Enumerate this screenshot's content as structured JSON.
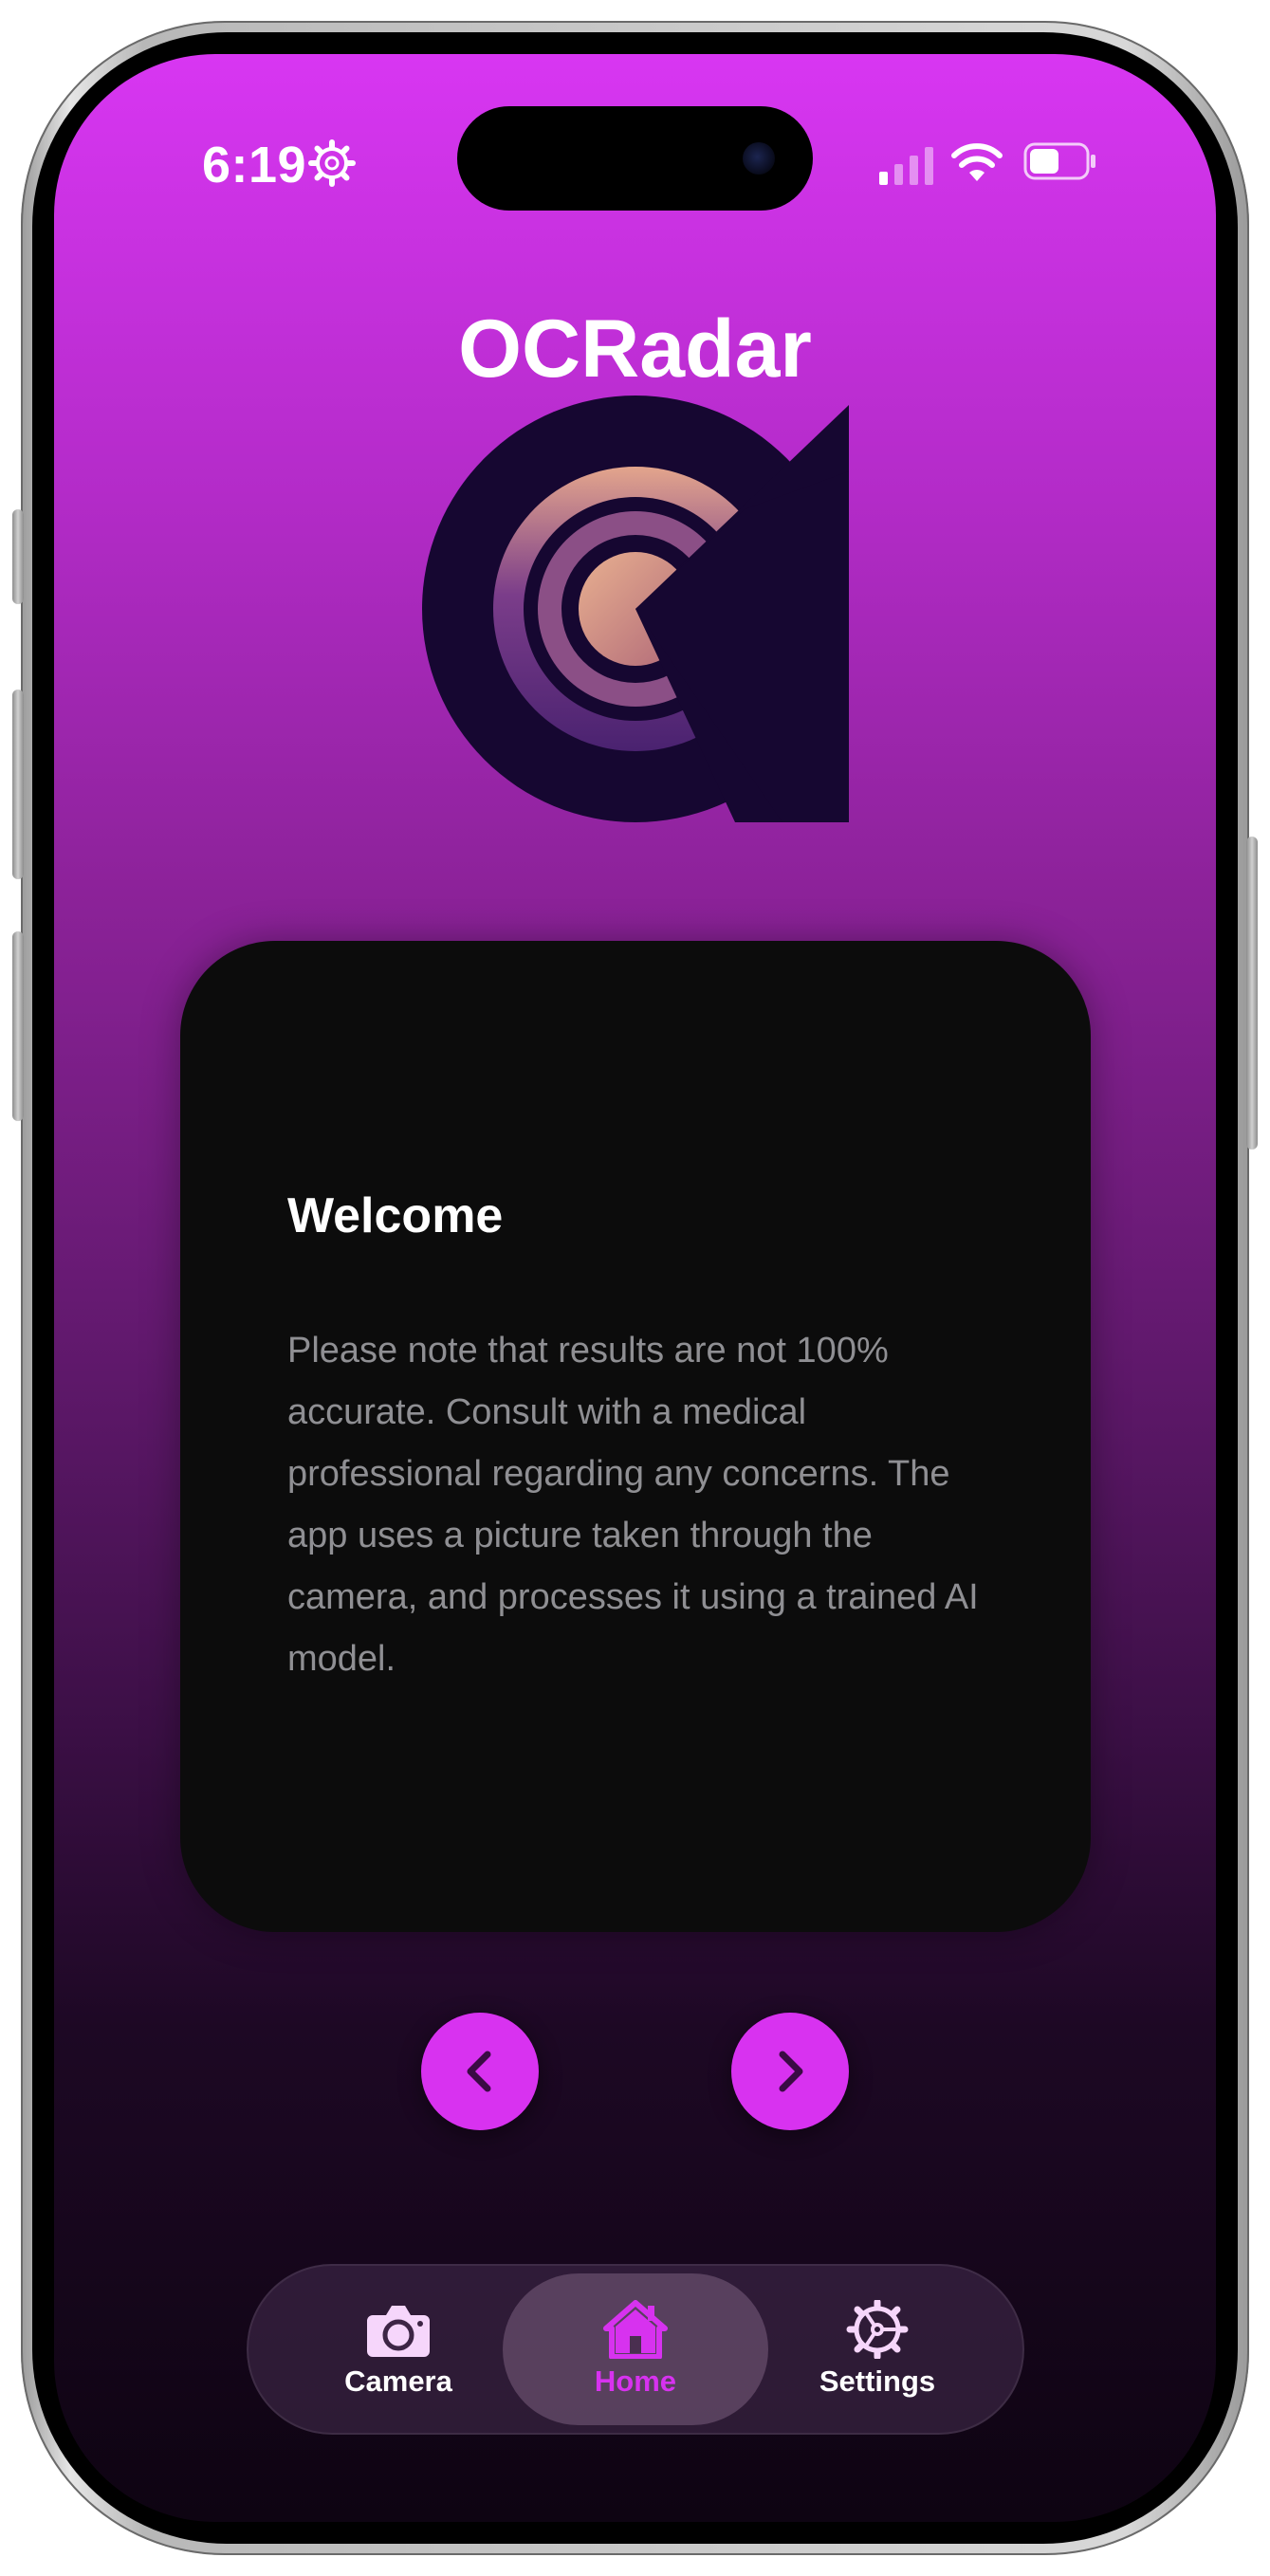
{
  "status_bar": {
    "time": "6:19",
    "icons": [
      "gear-icon",
      "signal-icon",
      "wifi-icon",
      "battery-icon"
    ]
  },
  "app": {
    "title": "OCRadar",
    "logo_icon": "ocradar-logo"
  },
  "card": {
    "title": "Welcome",
    "body": "Please note that results are not 100% accurate. Consult with a medical professional regarding any concerns. The app uses a picture taken through the camera, and processes it using a trained AI model."
  },
  "navigation": {
    "prev_icon": "chevron-left-icon",
    "next_icon": "chevron-right-icon"
  },
  "tabbar": {
    "tabs": [
      {
        "label": "Camera",
        "icon": "camera-icon",
        "active": false
      },
      {
        "label": "Home",
        "icon": "house-icon",
        "active": true
      },
      {
        "label": "Settings",
        "icon": "gear-icon",
        "active": false
      }
    ]
  },
  "colors": {
    "accent": "#d832f0",
    "gradient_top": "#d836f2",
    "gradient_bottom": "#0e0412",
    "card_background": "#0c0c0c",
    "body_text": "#8f8f93"
  }
}
